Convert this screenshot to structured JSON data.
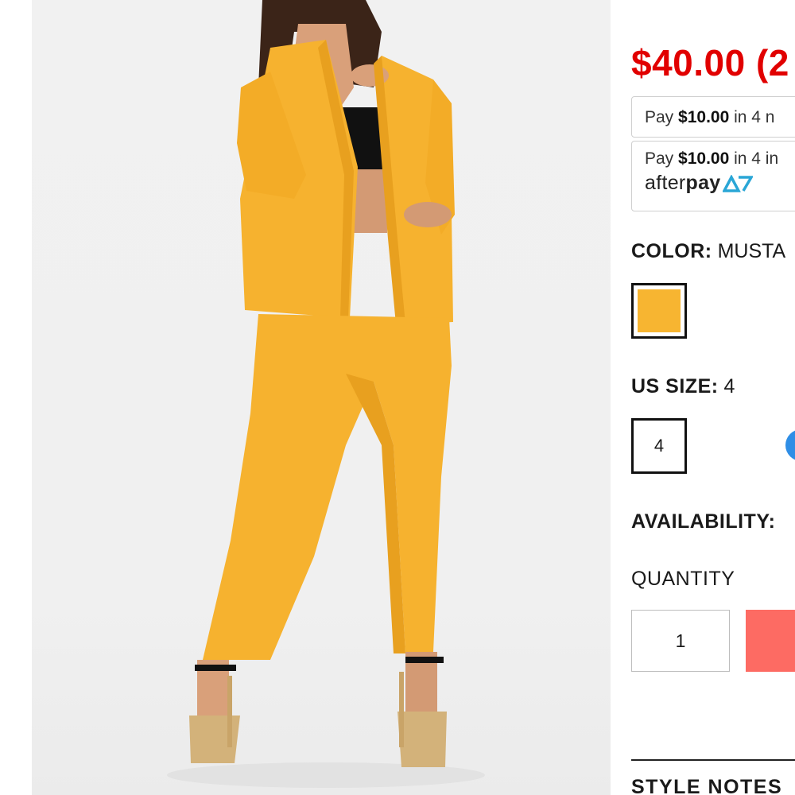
{
  "product": {
    "price": "$40.00 (2",
    "colors": {
      "price": "#e10000",
      "swatch": "#f7b531",
      "add_button": "#fd6b63",
      "size_chart_icon": "#2f8ee6"
    }
  },
  "payment": {
    "option1": {
      "prefix": "Pay",
      "amount": "$10.00",
      "suffix": "in 4 n"
    },
    "option2": {
      "prefix": "Pay",
      "amount": "$10.00",
      "suffix": "in 4 in"
    },
    "afterpay_light": "after",
    "afterpay_bold": "pay"
  },
  "color": {
    "label": "COLOR:",
    "value": "MUSTA"
  },
  "size": {
    "label": "US SIZE:",
    "value": "4",
    "option": "4"
  },
  "availability": {
    "label": "AVAILABILITY:"
  },
  "quantity": {
    "label": "QUANTITY",
    "value": "1"
  },
  "style_notes": {
    "label": "STYLE NOTES"
  }
}
